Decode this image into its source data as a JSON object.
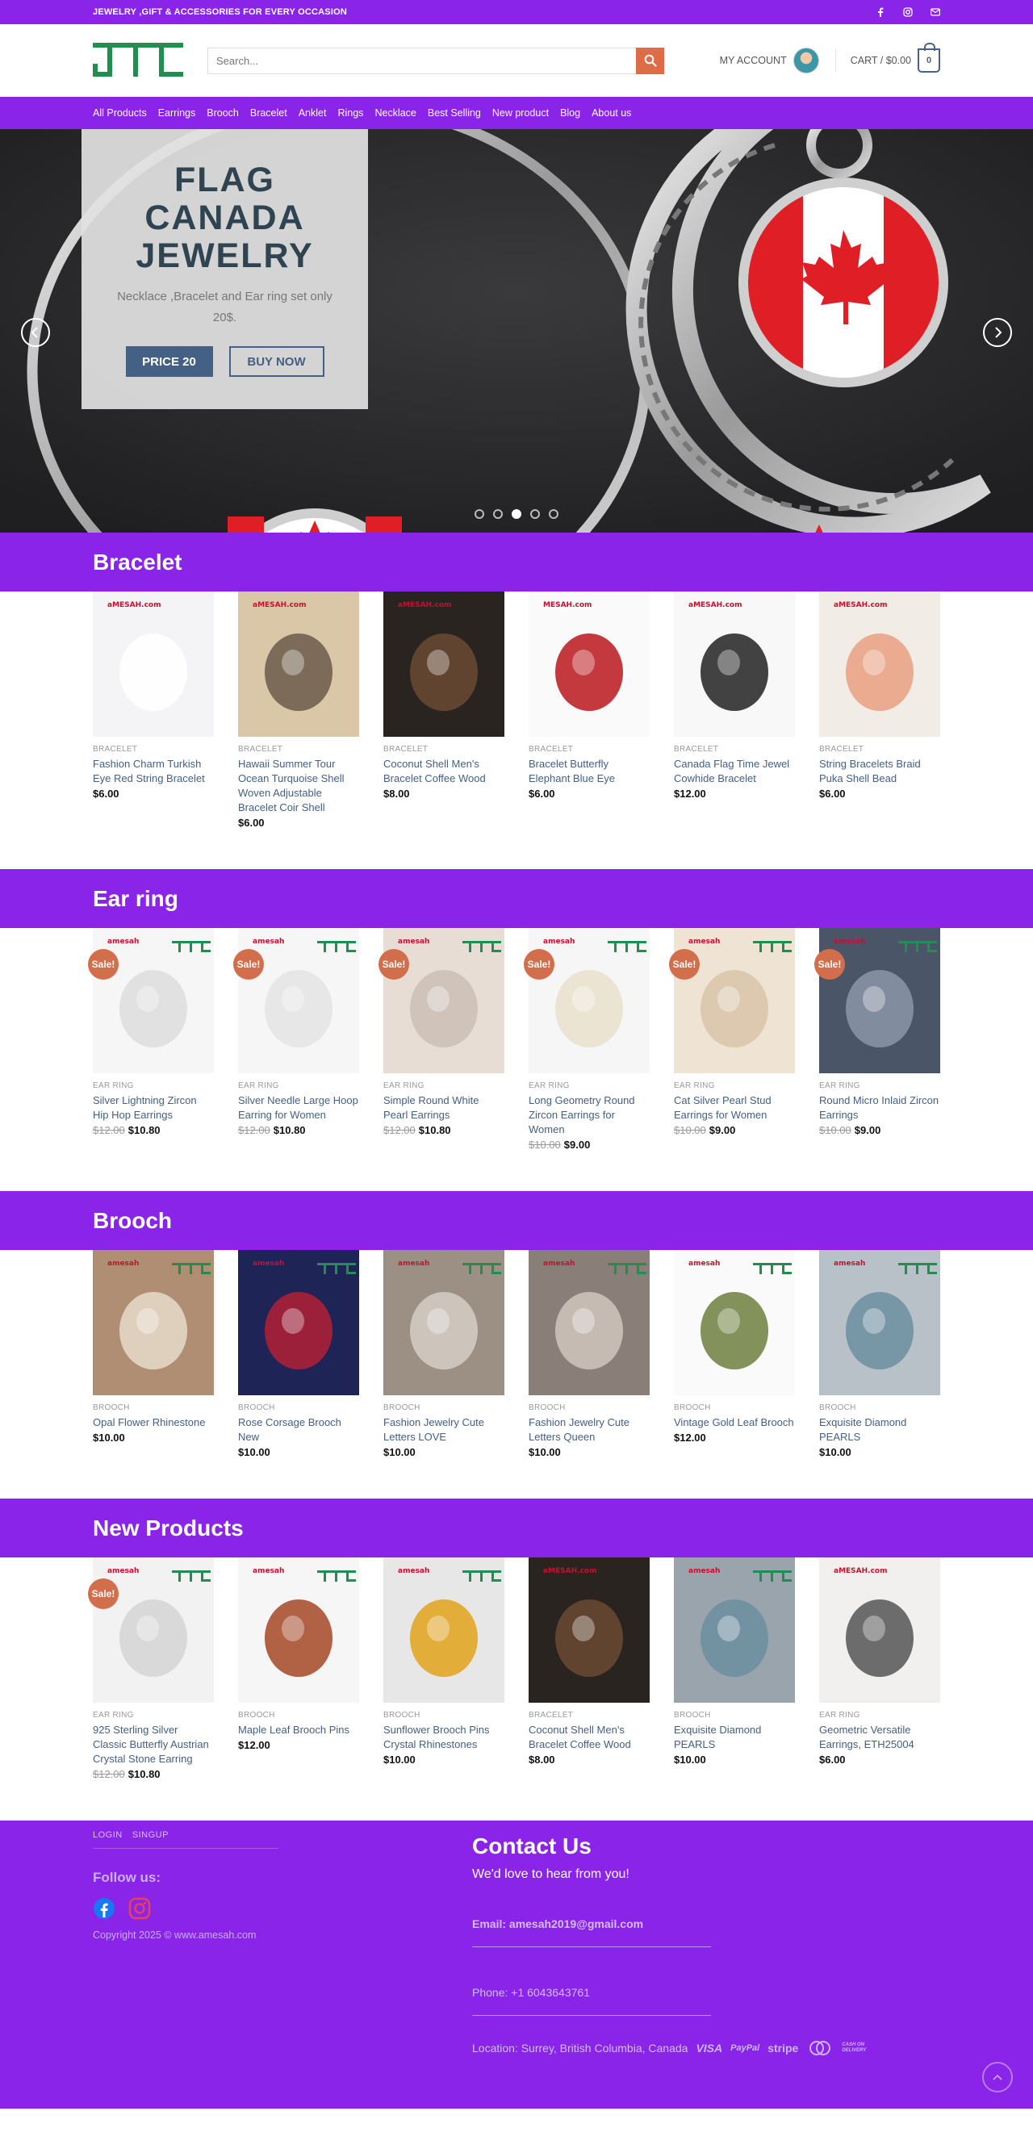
{
  "topbar": {
    "text": "JEWELRY ,GIFT & ACCESSORIES FOR EVERY OCCASION",
    "icons": [
      "facebook-icon",
      "instagram-icon",
      "email-icon"
    ]
  },
  "header": {
    "logo_text": "JTC",
    "search_placeholder": "Search...",
    "account_label": "MY ACCOUNT",
    "cart_label": "CART / $0.00",
    "cart_count": "0"
  },
  "nav": [
    "All Products",
    "Earrings",
    "Brooch",
    "Bracelet",
    "Anklet",
    "Rings",
    "Necklace",
    "Best Selling",
    "New product",
    "Blog",
    "About us"
  ],
  "hero": {
    "title": "FLAG\nCANADA\nJEWELRY",
    "subtitle": "Necklace ,Bracelet and Ear ring set only 20$.",
    "primary_button": "PRICE 20",
    "secondary_button": "BUY NOW",
    "slide_count": 5,
    "active_slide": 3
  },
  "sections": [
    {
      "title": "Bracelet",
      "products": [
        {
          "category": "BRACELET",
          "name": "Fashion Charm Turkish Eye Red String Bracelet",
          "price": "$6.00",
          "old_price": "",
          "sale": false,
          "tag": "aMESAH.com"
        },
        {
          "category": "BRACELET",
          "name": "Hawaii Summer Tour Ocean Turquoise Shell Woven Adjustable Bracelet Coir Shell",
          "price": "$6.00",
          "old_price": "",
          "sale": false,
          "tag": "aMESAH.com"
        },
        {
          "category": "BRACELET",
          "name": "Coconut Shell Men's Bracelet Coffee Wood",
          "price": "$8.00",
          "old_price": "",
          "sale": false,
          "tag": "aMESAH.com"
        },
        {
          "category": "BRACELET",
          "name": "Bracelet Butterfly Elephant Blue Eye",
          "price": "$6.00",
          "old_price": "",
          "sale": false,
          "tag": "MESAH.com"
        },
        {
          "category": "BRACELET",
          "name": "Canada Flag Time Jewel Cowhide Bracelet",
          "price": "$12.00",
          "old_price": "",
          "sale": false,
          "tag": "aMESAH.com"
        },
        {
          "category": "BRACELET",
          "name": " String Bracelets Braid Puka Shell Bead",
          "price": "$6.00",
          "old_price": "",
          "sale": false,
          "tag": "aMESAH.com"
        }
      ]
    },
    {
      "title": "Ear ring",
      "products": [
        {
          "category": "EAR RING",
          "name": "Silver Lightning Zircon Hip Hop Earrings",
          "price": "$10.80",
          "old_price": "$12.00",
          "sale": true,
          "tag": "amesah"
        },
        {
          "category": "EAR RING",
          "name": "Silver Needle Large Hoop Earring for Women",
          "price": "$10.80",
          "old_price": "$12.00",
          "sale": true,
          "tag": "amesah"
        },
        {
          "category": "EAR RING",
          "name": "Simple Round White Pearl Earrings",
          "price": "$10.80",
          "old_price": "$12.00",
          "sale": true,
          "tag": "amesah"
        },
        {
          "category": "EAR RING",
          "name": "Long Geometry Round Zircon Earrings for Women",
          "price": "$9.00",
          "old_price": "$10.00",
          "sale": true,
          "tag": "amesah"
        },
        {
          "category": "EAR RING",
          "name": " Cat Silver Pearl Stud Earrings for Women",
          "price": "$9.00",
          "old_price": "$10.00",
          "sale": true,
          "tag": "amesah"
        },
        {
          "category": "EAR RING",
          "name": "Round Micro Inlaid Zircon Earrings",
          "price": "$9.00",
          "old_price": "$10.00",
          "sale": true,
          "tag": "amesah"
        }
      ]
    },
    {
      "title": "Brooch",
      "products": [
        {
          "category": "BROOCH",
          "name": "Opal Flower Rhinestone",
          "price": "$10.00",
          "old_price": "",
          "sale": false,
          "tag": "amesah"
        },
        {
          "category": "BROOCH",
          "name": "Rose Corsage Brooch New",
          "price": "$10.00",
          "old_price": "",
          "sale": false,
          "tag": "amesah"
        },
        {
          "category": "BROOCH",
          "name": "Fashion Jewelry Cute Letters LOVE",
          "price": "$10.00",
          "old_price": "",
          "sale": false,
          "tag": "amesah"
        },
        {
          "category": "BROOCH",
          "name": "Fashion Jewelry Cute Letters Queen",
          "price": "$10.00",
          "old_price": "",
          "sale": false,
          "tag": "amesah"
        },
        {
          "category": "BROOCH",
          "name": "Vintage Gold Leaf Brooch",
          "price": "$12.00",
          "old_price": "",
          "sale": false,
          "tag": "amesah"
        },
        {
          "category": "BROOCH",
          "name": "Exquisite Diamond PEARLS",
          "price": "$10.00",
          "old_price": "",
          "sale": false,
          "tag": "amesah"
        }
      ]
    },
    {
      "title": "New Products",
      "products": [
        {
          "category": "EAR RING",
          "name": "925 Sterling Silver Classic Butterfly Austrian Crystal Stone Earring",
          "price": "$10.80",
          "old_price": "$12.00",
          "sale": true,
          "tag": "amesah"
        },
        {
          "category": "BROOCH",
          "name": "Maple Leaf Brooch Pins",
          "price": "$12.00",
          "old_price": "",
          "sale": false,
          "tag": "amesah"
        },
        {
          "category": "BROOCH",
          "name": "Sunflower Brooch Pins Crystal Rhinestones",
          "price": "$10.00",
          "old_price": "",
          "sale": false,
          "tag": "amesah"
        },
        {
          "category": "BRACELET",
          "name": "Coconut Shell Men's Bracelet Coffee Wood",
          "price": "$8.00",
          "old_price": "",
          "sale": false,
          "tag": "aMESAH.com"
        },
        {
          "category": "BROOCH",
          "name": "Exquisite Diamond PEARLS",
          "price": "$10.00",
          "old_price": "",
          "sale": false,
          "tag": "amesah"
        },
        {
          "category": "EAR RING",
          "name": "Geometric Versatile Earrings, ETH25004",
          "price": "$6.00",
          "old_price": "",
          "sale": false,
          "tag": "aMESAH.com"
        }
      ]
    }
  ],
  "footer": {
    "login": "LOGIN",
    "signup": "SINGUP",
    "follow": "Follow us:",
    "copyright": "Copyright 2025 © www.amesah.com",
    "contact_title": "Contact Us",
    "contact_sub": "We'd love to hear from you!",
    "email": "Email: amesah2019@gmail.com",
    "phone": "Phone: +1 6043643761",
    "location": "Location: Surrey, British Columbia, Canada",
    "payments": [
      "VISA",
      "PayPal",
      "stripe",
      "",
      "CASH ON DELIVERY"
    ]
  }
}
